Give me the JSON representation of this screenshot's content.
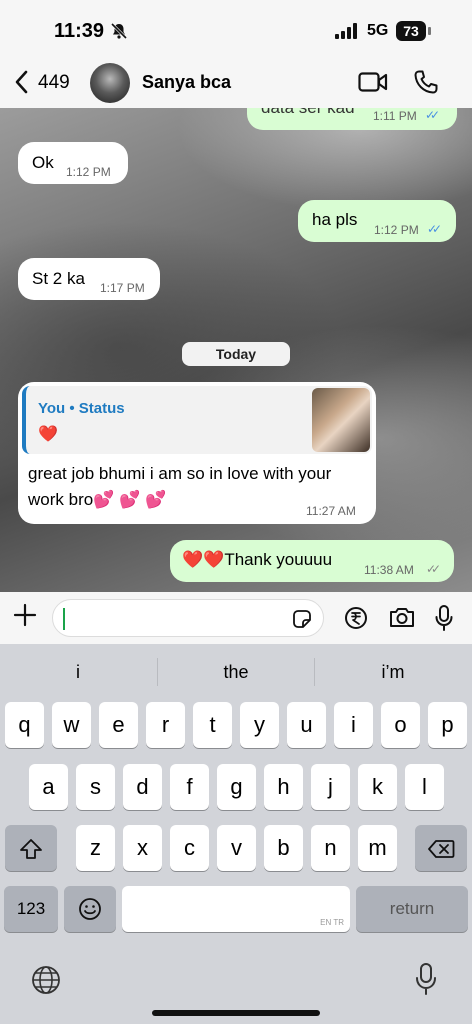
{
  "status": {
    "time": "11:39",
    "network": "5G",
    "battery": "73"
  },
  "header": {
    "back_count": "449",
    "contact_name": "Sanya bca"
  },
  "messages": [
    {
      "dir": "out",
      "text": "data ser kad",
      "time": "1:11 PM"
    },
    {
      "dir": "in",
      "text": "Ok",
      "time": "1:12 PM"
    },
    {
      "dir": "out",
      "text": "ha pls",
      "time": "1:12 PM"
    },
    {
      "dir": "in",
      "text": "St 2 ka",
      "time": "1:17 PM"
    },
    {
      "dir": "in",
      "reply_title": "You • Status",
      "reply_heart": "❤️",
      "text1": "great job bhumi i am so in love with your",
      "text2": "work bro💕 💕 💕",
      "time": "11:27 AM"
    },
    {
      "dir": "out",
      "text": "❤️❤️Thank youuuu",
      "time": "11:38 AM"
    }
  ],
  "day_separator": "Today",
  "keyboard": {
    "suggestions": [
      "i",
      "the",
      "i’m"
    ],
    "row1": [
      "q",
      "w",
      "e",
      "r",
      "t",
      "y",
      "u",
      "i",
      "o",
      "p"
    ],
    "row2": [
      "a",
      "s",
      "d",
      "f",
      "g",
      "h",
      "j",
      "k",
      "l"
    ],
    "row3": [
      "z",
      "x",
      "c",
      "v",
      "b",
      "n",
      "m"
    ],
    "numbers_label": "123",
    "space_lang": "EN TR",
    "return_label": "return"
  },
  "colors": {
    "outgoing": "#d9fdd3",
    "incoming": "#ffffff",
    "read_ticks": "#4a90e2",
    "accent": "#1f7bc1"
  }
}
